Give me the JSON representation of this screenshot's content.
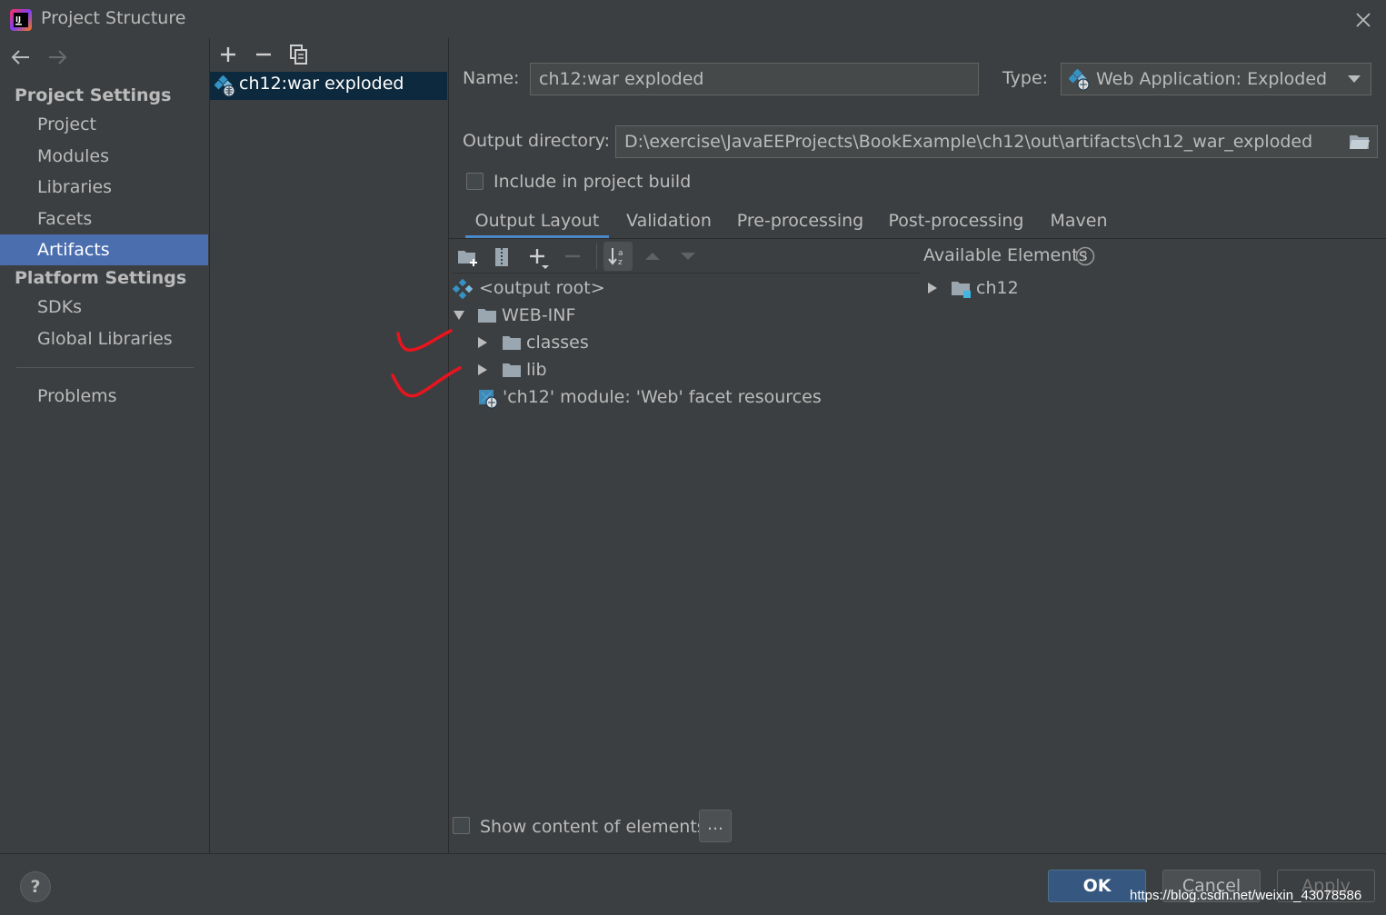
{
  "window": {
    "title": "Project Structure"
  },
  "nav": {
    "project_settings_header": "Project Settings",
    "project_settings_items": [
      "Project",
      "Modules",
      "Libraries",
      "Facets",
      "Artifacts"
    ],
    "selected_item": "Artifacts",
    "platform_settings_header": "Platform Settings",
    "platform_settings_items": [
      "SDKs",
      "Global Libraries"
    ],
    "problems_item": "Problems"
  },
  "artifacts_list": {
    "items": [
      "ch12:war exploded"
    ],
    "selected": "ch12:war exploded"
  },
  "artifact": {
    "name_label": "Name:",
    "name_value": "ch12:war exploded",
    "type_label": "Type:",
    "type_value": "Web Application: Exploded",
    "output_dir_label": "Output directory:",
    "output_dir_value": "D:\\exercise\\JavaEEProjects\\BookExample\\ch12\\out\\artifacts\\ch12_war_exploded",
    "include_in_build_label": "Include in project build",
    "include_in_build_checked": false
  },
  "tabs": [
    "Output Layout",
    "Validation",
    "Pre-processing",
    "Post-processing",
    "Maven"
  ],
  "active_tab": "Output Layout",
  "output_layout": {
    "tree": [
      {
        "label": "<output root>",
        "depth": 0,
        "icon": "output-root-icon"
      },
      {
        "label": "WEB-INF",
        "depth": 0,
        "icon": "folder-icon",
        "expanded": true
      },
      {
        "label": "classes",
        "depth": 1,
        "icon": "folder-icon",
        "expanded": false
      },
      {
        "label": "lib",
        "depth": 1,
        "icon": "folder-icon",
        "expanded": false
      },
      {
        "label": "'ch12' module: 'Web' facet resources",
        "depth": 0,
        "icon": "web-facet-icon"
      }
    ],
    "available_elements_label": "Available Elements",
    "available_elements": [
      {
        "label": "ch12",
        "icon": "module-folder-icon",
        "expanded": false
      }
    ],
    "show_content_label": "Show content of elements",
    "show_content_checked": false,
    "dots_button": "..."
  },
  "buttons": {
    "ok": "OK",
    "cancel": "Cancel",
    "apply": "Apply",
    "help": "?"
  },
  "watermark": "https://blog.csdn.net/weixin_43078586",
  "colors": {
    "background": "#3c3f41",
    "selection": "#4b6eaf",
    "list_selection": "#0d293e",
    "accent": "#4a88c7",
    "annotation_red": "#e8141e"
  }
}
